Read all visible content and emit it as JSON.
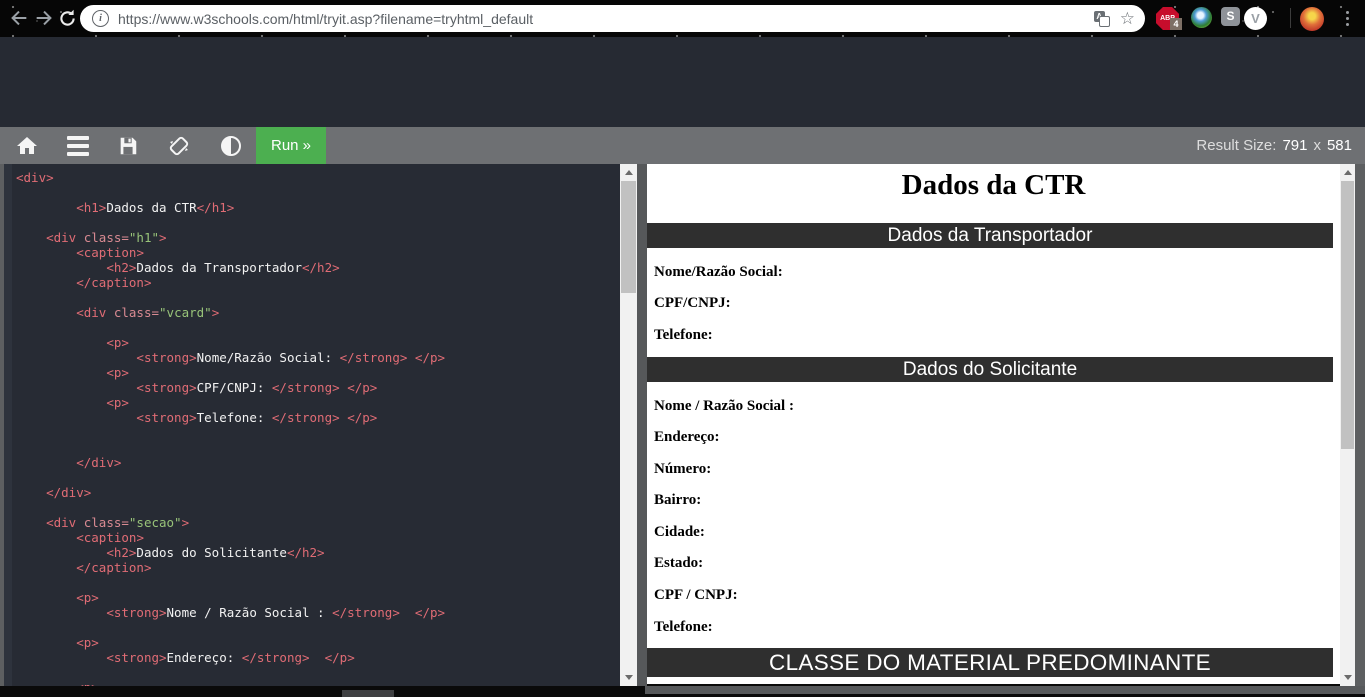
{
  "browser": {
    "url": "https://www.w3schools.com/html/tryit.asp?filename=tryhtml_default",
    "extensions": {
      "adblock_label": "ABP",
      "adblock_badge": "4",
      "s_label": "S",
      "v_label": "V"
    }
  },
  "toolbar": {
    "run_label": "Run »",
    "result_size": {
      "label": "Result Size:",
      "width": "791",
      "sep": "x",
      "height": "581"
    }
  },
  "editor": {
    "code_lines": [
      "<div>",
      "",
      "        <h1>Dados da CTR</h1>",
      "",
      "    <div class=\"h1\">",
      "        <caption>",
      "            <h2>Dados da Transportador</h2>",
      "        </caption>",
      "",
      "        <div class=\"vcard\">",
      "",
      "            <p>",
      "                <strong>Nome/Razão Social: </strong> </p>",
      "            <p>",
      "                <strong>CPF/CNPJ: </strong> </p>",
      "            <p>",
      "                <strong>Telefone: </strong> </p>",
      "",
      "",
      "        </div>",
      "",
      "    </div>",
      "",
      "    <div class=\"secao\">",
      "        <caption>",
      "            <h2>Dados do Solicitante</h2>",
      "        </caption>",
      "",
      "        <p>",
      "            <strong>Nome / Razão Social : </strong>  </p>",
      "",
      "        <p>",
      "            <strong>Endereço: </strong>  </p>",
      "",
      "        <p>"
    ],
    "syntax_colors": {
      "tag": "#e06c75",
      "attribute": "#d98a92",
      "string": "#98c379",
      "text": "#f2f2f2",
      "background": "#272b34"
    }
  },
  "result": {
    "title": "Dados da CTR",
    "sections": [
      {
        "header": "Dados da Transportador",
        "fields": [
          "Nome/Razão Social:",
          "CPF/CNPJ:",
          "Telefone:"
        ]
      },
      {
        "header": "Dados do Solicitante",
        "fields": [
          "Nome / Razão Social :",
          "Endereço:",
          "Número:",
          "Bairro:",
          "Cidade:",
          "Estado:",
          "CPF / CNPJ:",
          "Telefone:"
        ]
      },
      {
        "header": "CLASSE DO MATERIAL PREDOMINANTE",
        "fields": []
      }
    ],
    "header_bar_color": "#2f2f2f"
  },
  "colors": {
    "accent_green": "#4caf50",
    "toolbar_gray": "#6e7073",
    "page_dark": "#262a33"
  }
}
